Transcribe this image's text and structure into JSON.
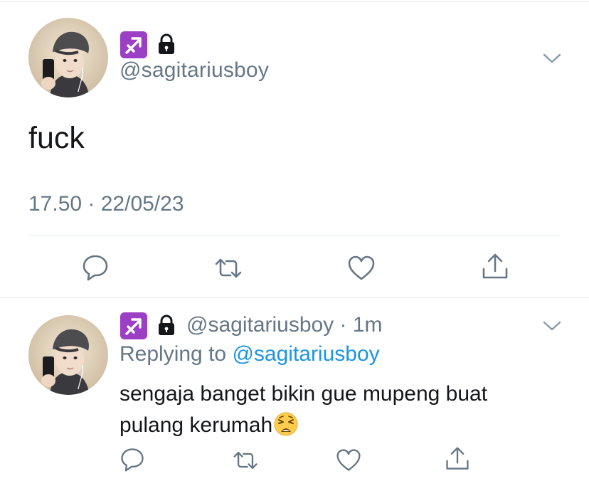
{
  "main_tweet": {
    "avatar_icon": "profile-photo-avatar",
    "zodiac_icon": "sagittarius-emoji-icon",
    "lock_icon": "lock-icon",
    "handle": "@sagitariusboy",
    "text": "fuck",
    "timestamp": "17.50 · 22/05/23",
    "actions": [
      "reply-icon",
      "retweet-icon",
      "like-icon",
      "share-icon"
    ]
  },
  "reply_tweet": {
    "avatar_icon": "profile-photo-avatar",
    "zodiac_icon": "sagittarius-emoji-icon",
    "lock_icon": "lock-icon",
    "handle_time": "@sagitariusboy · 1m",
    "replying_prefix": "Replying to ",
    "replying_mention": "@sagitariusboy",
    "text": "sengaja banget bikin gue mupeng buat pulang kerumah",
    "trailing_emoji": "weary-face-emoji",
    "actions": [
      "reply-icon",
      "retweet-icon",
      "like-icon",
      "share-icon"
    ]
  },
  "colors": {
    "secondary_text": "#657786",
    "link": "#1b95e0",
    "divider": "#e6ecf0",
    "badge_purple": "#9b3fc4"
  }
}
